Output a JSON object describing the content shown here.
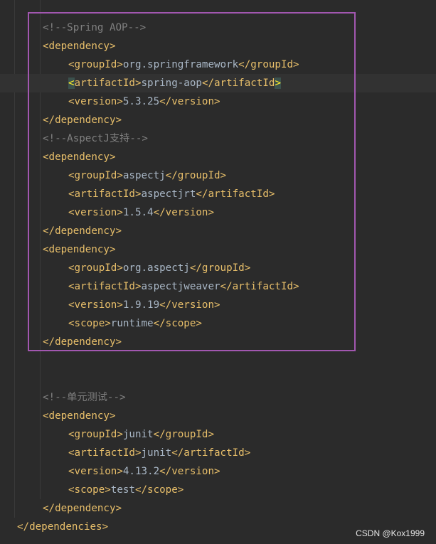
{
  "comments": {
    "spring_aop": "<!--Spring AOP-->",
    "aspectj": "<!--AspectJ支持-->",
    "unit_test": "<!--单元测试-->"
  },
  "tags": {
    "dependency_open": "<dependency>",
    "dependency_close": "</dependency>",
    "dependencies_close": "</dependencies>",
    "groupId_open": "<groupId>",
    "groupId_close": "</groupId>",
    "artifactId_open": "<",
    "artifactId_open_name": "artifactId",
    "artifactId_open_end": ">",
    "artifactId_open_full": "<artifactId>",
    "artifactId_close_start": "</artifactId",
    "artifactId_close_end": ">",
    "artifactId_close_full": "</artifactId>",
    "version_open": "<version>",
    "version_close": "</version>",
    "scope_open": "<scope>",
    "scope_close": "</scope>"
  },
  "dependencies": [
    {
      "groupId": "org.springframework",
      "artifactId": "spring-aop",
      "version": "5.3.25"
    },
    {
      "groupId": "aspectj",
      "artifactId": "aspectjrt",
      "version": "1.5.4"
    },
    {
      "groupId": "org.aspectj",
      "artifactId": "aspectjweaver",
      "version": "1.9.19",
      "scope": "runtime"
    },
    {
      "groupId": "junit",
      "artifactId": "junit",
      "version": "4.13.2",
      "scope": "test"
    }
  ],
  "watermark": "CSDN @Kox1999"
}
